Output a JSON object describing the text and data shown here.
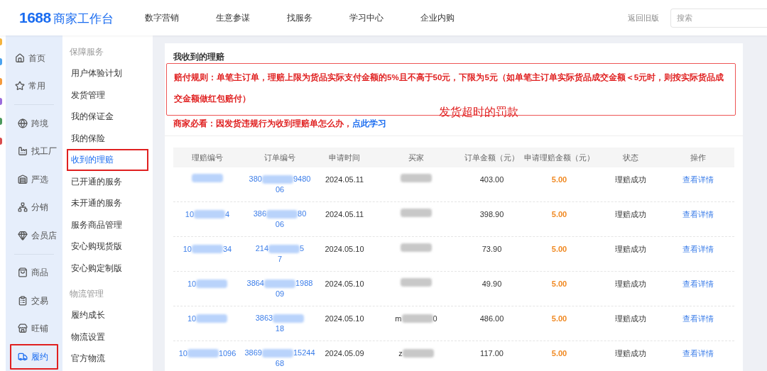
{
  "header": {
    "logo_number": "1688",
    "logo_text": "商家工作台",
    "menu": [
      "数字营销",
      "生意参谋",
      "找服务",
      "学习中心",
      "企业内购"
    ],
    "old_version": "返回旧版",
    "search": {
      "placeholder": "搜索"
    }
  },
  "nav": [
    {
      "items": [
        {
          "label": "首页",
          "selected": false,
          "highlighted": false
        },
        {
          "label": "常用",
          "selected": false,
          "highlighted": false
        }
      ]
    },
    {
      "items": [
        {
          "label": "跨境",
          "selected": false,
          "highlighted": false
        },
        {
          "label": "找工厂",
          "selected": false,
          "highlighted": false
        },
        {
          "label": "严选",
          "selected": false,
          "highlighted": false
        },
        {
          "label": "分销",
          "selected": false,
          "highlighted": false
        },
        {
          "label": "会员店",
          "selected": false,
          "highlighted": false
        }
      ]
    },
    {
      "items": [
        {
          "label": "商品",
          "selected": false,
          "highlighted": false
        },
        {
          "label": "交易",
          "selected": false,
          "highlighted": false
        },
        {
          "label": "旺铺",
          "selected": false,
          "highlighted": false
        },
        {
          "label": "履约",
          "selected": true,
          "highlighted": true
        }
      ]
    }
  ],
  "submenu": [
    {
      "title": "保障服务",
      "items": [
        {
          "label": "用户体验计划",
          "selected": false,
          "highlighted": false
        },
        {
          "label": "发货管理",
          "selected": false,
          "highlighted": false
        },
        {
          "label": "我的保证金",
          "selected": false,
          "highlighted": false
        },
        {
          "label": "我的保险",
          "selected": false,
          "highlighted": false
        },
        {
          "label": "收到的理赔",
          "selected": true,
          "highlighted": true
        },
        {
          "label": "已开通的服务",
          "selected": false,
          "highlighted": false
        },
        {
          "label": "未开通的服务",
          "selected": false,
          "highlighted": false
        },
        {
          "label": "服务商品管理",
          "selected": false,
          "highlighted": false
        },
        {
          "label": "安心购现货版",
          "selected": false,
          "highlighted": false
        },
        {
          "label": "安心购定制版",
          "selected": false,
          "highlighted": false
        }
      ]
    },
    {
      "title": "物流管理",
      "items": [
        {
          "label": "履约成长",
          "selected": false,
          "highlighted": false
        },
        {
          "label": "物流设置",
          "selected": false,
          "highlighted": false
        },
        {
          "label": "官方物流",
          "selected": false,
          "highlighted": false
        }
      ]
    }
  ],
  "page_title": "我收到的理赔",
  "notice": {
    "rule": "赔付规则：单笔主订单，理赔上限为货品实际支付金额的5%且不高于50元，下限为5元（如单笔主订单实际货品成交金额＜5元时，则按实际货品成交金额做红包赔付）",
    "tip": "商家必看：因发货违规行为收到理赔单怎么办，",
    "link": "点此学习",
    "annotation": "发货超时的罚款"
  },
  "table": {
    "columns": [
      "理赔编号",
      "订单编号",
      "申请时间",
      "买家",
      "订单金额（元）",
      "申请理赔金额（元）",
      "状态",
      "操作"
    ],
    "rows": [
      {
        "claim_start": "",
        "claim_end": "",
        "order_start": "380",
        "order_end": "9480",
        "order_line2": "06",
        "date": "2024.05.11",
        "buyer_start": "",
        "buyer_end": "",
        "amount": "403.00",
        "claim_amount": "5.00",
        "status": "理赔成功",
        "action": "查看详情"
      },
      {
        "claim_start": "10",
        "claim_end": "4",
        "order_start": "386",
        "order_end": "80",
        "order_line2": "06",
        "date": "2024.05.11",
        "buyer_start": "",
        "buyer_end": "",
        "amount": "398.90",
        "claim_amount": "5.00",
        "status": "理赔成功",
        "action": "查看详情"
      },
      {
        "claim_start": "10",
        "claim_end": "34",
        "order_start": "214",
        "order_end": "5",
        "order_line2": "7",
        "date": "2024.05.10",
        "buyer_start": "",
        "buyer_end": "",
        "amount": "73.90",
        "claim_amount": "5.00",
        "status": "理赔成功",
        "action": "查看详情"
      },
      {
        "claim_start": "10",
        "claim_end": "",
        "order_start": "3864",
        "order_end": "1988",
        "order_line2": "09",
        "date": "2024.05.10",
        "buyer_start": "",
        "buyer_end": "",
        "amount": "49.90",
        "claim_amount": "5.00",
        "status": "理赔成功",
        "action": "查看详情"
      },
      {
        "claim_start": "10",
        "claim_end": "",
        "order_start": "3863",
        "order_end": "",
        "order_line2": "18",
        "date": "2024.05.10",
        "buyer_start": "m",
        "buyer_end": "0",
        "amount": "486.00",
        "claim_amount": "5.00",
        "status": "理赔成功",
        "action": "查看详情"
      },
      {
        "claim_start": "10",
        "claim_end": "1096",
        "order_start": "3869",
        "order_end": "15244",
        "order_line2": "68",
        "date": "2024.05.09",
        "buyer_start": "z",
        "buyer_end": "",
        "amount": "117.00",
        "claim_amount": "5.00",
        "status": "理赔成功",
        "action": "查看详情"
      }
    ]
  }
}
